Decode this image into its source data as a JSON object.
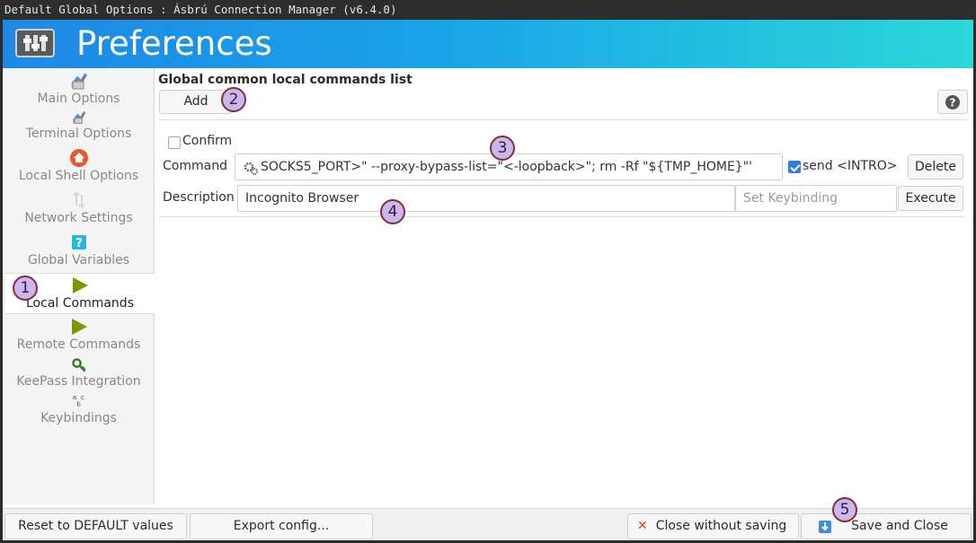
{
  "window": {
    "title": "Default Global Options : Ásbrú Connection Manager (v6.4.0)"
  },
  "header": {
    "title": "Preferences",
    "logo_icon": "preferences-sliders-icon"
  },
  "sidebar": {
    "items": [
      {
        "label": "Main Options",
        "icon": "main-options-icon"
      },
      {
        "label": "Terminal Options",
        "icon": "terminal-options-icon"
      },
      {
        "label": "Local Shell Options",
        "icon": "home-icon"
      },
      {
        "label": "Network Settings",
        "icon": "network-arrows-icon"
      },
      {
        "label": "Global Variables",
        "icon": "question-box-icon"
      },
      {
        "label": "Local Commands",
        "icon": "play-icon"
      },
      {
        "label": "Remote Commands",
        "icon": "play-icon"
      },
      {
        "label": "KeePass Integration",
        "icon": "keepass-key-icon"
      },
      {
        "label": "Keybindings",
        "icon": "abc-icon"
      }
    ]
  },
  "main": {
    "section_title": "Global common local commands list",
    "add_label": "Add",
    "help_icon": "help-icon",
    "command_item": {
      "confirm_label": "Confirm",
      "confirm_checked": false,
      "command_label": "Command",
      "command_value": "SOCKS5_PORT>\" --proxy-bypass-list=\"<-loopback>\"; rm -Rf \"${TMP_HOME}\"'",
      "send_intro_label": "send <INTRO>",
      "send_intro_checked": true,
      "delete_label": "Delete",
      "description_label": "Description",
      "description_value": "Incognito Browser",
      "keybinding_placeholder": "Set Keybinding",
      "execute_label": "Execute"
    }
  },
  "footer": {
    "reset_label": "Reset to DEFAULT values",
    "export_label": "Export config...",
    "close_nosave_label": "Close without saving",
    "save_close_label": "Save and Close"
  },
  "markers": [
    "1",
    "2",
    "3",
    "4",
    "5"
  ],
  "colors": {
    "accent": "#2e7de1",
    "header_start": "#1e88e5",
    "header_end": "#2bd8d8",
    "play_green": "#7a9a00",
    "close_red": "#e53935"
  }
}
